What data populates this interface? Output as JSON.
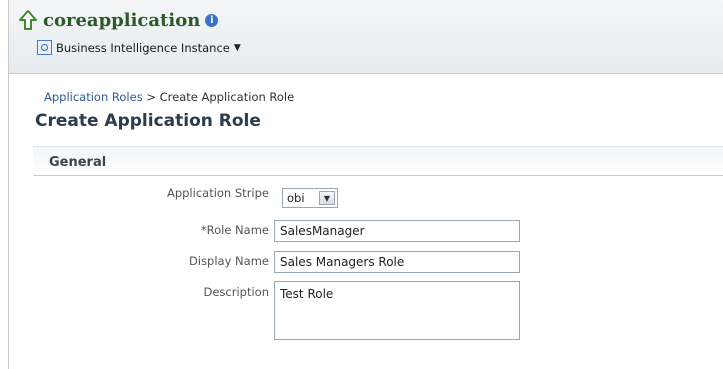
{
  "header": {
    "app_name": "coreapplication",
    "info_symbol": "i",
    "instance_menu_label": "Business Intelligence Instance",
    "caret": "▼",
    "up_icon": "up-arrow-icon",
    "instance_icon": "target-icon"
  },
  "breadcrumb": {
    "link_label": "Application Roles",
    "separator": ">",
    "current": "Create Application Role"
  },
  "page_title": "Create Application Role",
  "section": {
    "title": "General"
  },
  "form": {
    "stripe_label": "Application Stripe",
    "stripe_value": "obi",
    "required_marker": "*",
    "role_name_label": "Role Name",
    "role_name_value": "SalesManager",
    "display_name_label": "Display Name",
    "display_name_value": "Sales Managers Role",
    "description_label": "Description",
    "description_value": "Test Role"
  },
  "colors": {
    "app_name": "#2b5a26",
    "link": "#2e5a9a",
    "header_bg": "#e7ebef"
  }
}
